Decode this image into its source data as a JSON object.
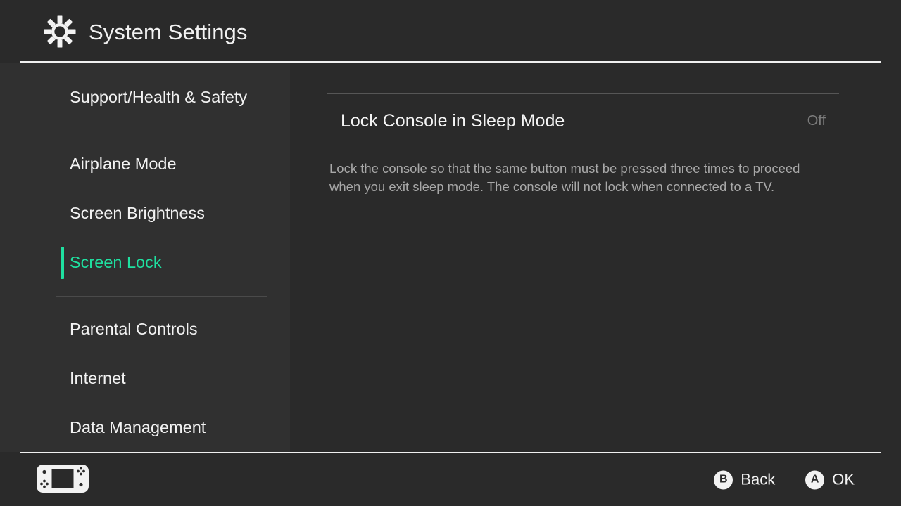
{
  "header": {
    "title": "System Settings",
    "icon": "gear-icon"
  },
  "sidebar": {
    "groups": [
      {
        "items": [
          {
            "label": "Support/Health & Safety",
            "selected": false
          }
        ]
      },
      {
        "items": [
          {
            "label": "Airplane Mode",
            "selected": false
          },
          {
            "label": "Screen Brightness",
            "selected": false
          },
          {
            "label": "Screen Lock",
            "selected": true
          }
        ]
      },
      {
        "items": [
          {
            "label": "Parental Controls",
            "selected": false
          },
          {
            "label": "Internet",
            "selected": false
          },
          {
            "label": "Data Management",
            "selected": false
          }
        ]
      }
    ],
    "accent_color": "#1fe0a0"
  },
  "main": {
    "setting": {
      "label": "Lock Console in Sleep Mode",
      "value": "Off",
      "description": "Lock the console so that the same button must be pressed three times to proceed when you exit sleep mode. The console will not lock when connected to a TV."
    }
  },
  "footer": {
    "console_icon": "switch-console-icon",
    "actions": [
      {
        "button": "B",
        "label": "Back"
      },
      {
        "button": "A",
        "label": "OK"
      }
    ]
  }
}
